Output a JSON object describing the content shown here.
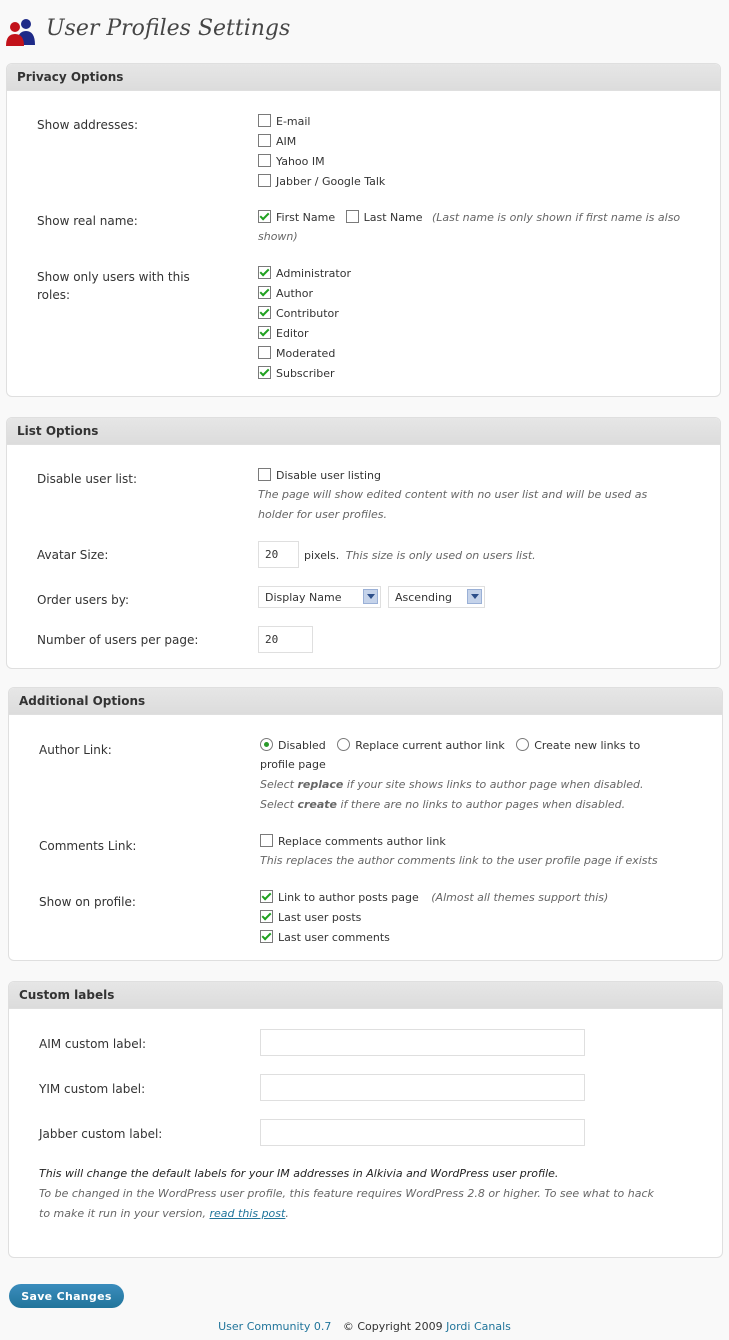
{
  "page": {
    "title": "User Profiles Settings",
    "icon": "users-icon"
  },
  "colors": {
    "link": "#21759b",
    "button": "#21759b",
    "check": "#21a121"
  },
  "privacy": {
    "title": "Privacy Options",
    "show_addresses": {
      "label": "Show addresses:",
      "options": [
        {
          "label": "E-mail",
          "checked": false
        },
        {
          "label": "AIM",
          "checked": false
        },
        {
          "label": "Yahoo IM",
          "checked": false
        },
        {
          "label": "Jabber / Google Talk",
          "checked": false
        }
      ]
    },
    "show_real_name": {
      "label": "Show real name:",
      "first": "First Name",
      "first_checked": true,
      "last": "Last Name",
      "last_checked": false,
      "note_a": "(Last name is only shown if first name is also",
      "note_b": "shown)"
    },
    "roles": {
      "label_line1": "Show only users with this",
      "label_line2": "roles:",
      "options": [
        {
          "label": "Administrator",
          "checked": true
        },
        {
          "label": "Author",
          "checked": true
        },
        {
          "label": "Contributor",
          "checked": true
        },
        {
          "label": "Editor",
          "checked": true
        },
        {
          "label": "Moderated",
          "checked": false
        },
        {
          "label": "Subscriber",
          "checked": true
        }
      ]
    }
  },
  "list": {
    "title": "List Options",
    "disable": {
      "label": "Disable user list:",
      "option": "Disable user listing",
      "checked": false,
      "note1": "The page will show edited content with no user list and will be used as",
      "note2": "holder for user profiles."
    },
    "avatar": {
      "label": "Avatar Size:",
      "value": "20",
      "unit": "pixels.",
      "note": "This size is only used on users list."
    },
    "order": {
      "label": "Order users by:",
      "field": "Display Name",
      "direction": "Ascending"
    },
    "per_page": {
      "label": "Number of users per page:",
      "value": "20"
    }
  },
  "additional": {
    "title": "Additional Options",
    "author_link": {
      "label": "Author Link:",
      "opt_disabled": "Disabled",
      "opt_replace": "Replace current author link",
      "opt_create": "Create new links to",
      "opt_create_cont": "profile page",
      "selected": "disabled",
      "note1_a": "Select ",
      "note1_b": "replace",
      "note1_c": " if your site shows links to author page when disabled.",
      "note2_a": "Select ",
      "note2_b": "create",
      "note2_c": " if there are no links to author pages when disabled."
    },
    "comments_link": {
      "label": "Comments Link:",
      "option": "Replace comments author link",
      "checked": false,
      "note": "This replaces the author comments link to the user profile page if exists"
    },
    "show_on_profile": {
      "label": "Show on profile:",
      "opt1": "Link to author posts page",
      "opt1_note": "(Almost all themes support this)",
      "opt2": "Last user posts",
      "opt3": "Last user comments",
      "checked": [
        true,
        true,
        true
      ]
    }
  },
  "custom": {
    "title": "Custom labels",
    "aim_label": "AIM custom label:",
    "aim_value": "",
    "yim_label": "YIM custom label:",
    "yim_value": "",
    "jabber_label": "Jabber custom label:",
    "jabber_value": "",
    "note1": "This will change the default labels for your IM addresses in Alkivia and WordPress user profile.",
    "note2": "To be changed in the WordPress user profile, this feature requires WordPress 2.8 or higher. To see what to hack",
    "note3_a": "to make it run in your version, ",
    "note3_link": "read this post",
    "note3_b": "."
  },
  "save_label": "Save Changes",
  "footer": {
    "plugin": "User Community 0.7",
    "copyright": "© Copyright 2009",
    "author": "Jordi Canals"
  }
}
